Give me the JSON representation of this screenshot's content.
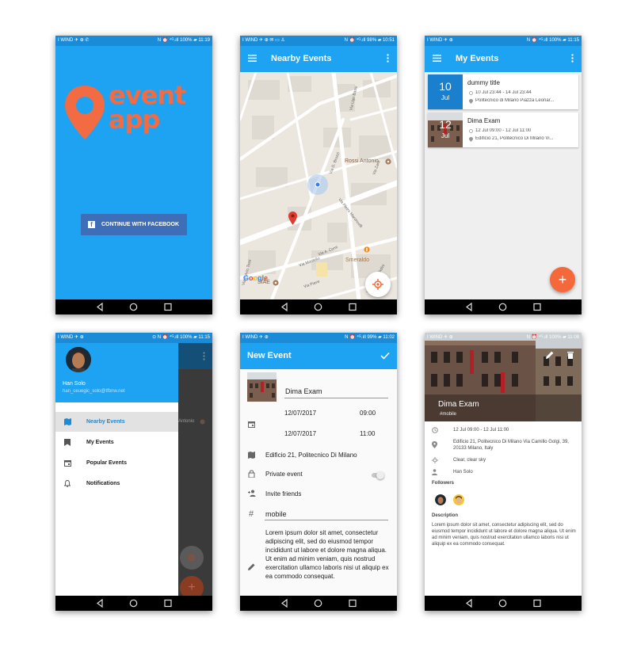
{
  "status": {
    "p1": {
      "left": "I WIND ✈ ⊕ ✆",
      "right": "N ⏰ ⁴ᴳ.ıll 100% ▰ 11:19"
    },
    "p2": {
      "left": "I WIND ✈ ⊕ ✉ ▭ ♙",
      "right": "N ⏰ ⁴ᴳ.ıll 98% ▰ 10:51"
    },
    "p3": {
      "left": "I WIND ✈ ⊕",
      "right": "N ⏰ ⁴ᴳ.ıll 100% ▰ 11:15"
    },
    "p4": {
      "left": "I WIND ✈ ⊕",
      "right": "⊙ N ⏰ ⁴ᴳ.ıll 100% ▰ 11:15"
    },
    "p5": {
      "left": "I WIND ✈ ⊕",
      "right": "N ⏰ ⁴ᴳ.ıll 99% ▰ 11:02"
    },
    "p6": {
      "left": "I WIND ✈ ⊕",
      "right": "N ⏰ ⁴ᴳ.ıll 100% ▰ 11:08"
    }
  },
  "splash": {
    "logo_line1": "event",
    "logo_line2": "app",
    "facebook_button": "CONTINUE WITH FACEBOOK",
    "facebook_icon": "f"
  },
  "nearby": {
    "title": "Nearby Events",
    "places": [
      "Rossi Antonio",
      "Smeraldo",
      "SIAE"
    ],
    "streets": [
      "Via Ugo Bassi",
      "Via G. Bruzzi",
      "Via Zara",
      "Via Fulvio Testi",
      "Via A. Comi",
      "Via Montello",
      "Via Pietro Maroncelli",
      "Via Piave",
      "Via Ettore Paladini"
    ],
    "google": "Google",
    "fab_label": "+"
  },
  "my_events": {
    "title": "My Events",
    "events": [
      {
        "day": "10",
        "month": "Jul",
        "title": "dummy title",
        "time": "10 Jul 23:44 - 14 Jul 23:44",
        "place": "Politecnico di Milano Piazza Leonar..."
      },
      {
        "day": "12",
        "month": "Jul",
        "title": "Dima Exam",
        "time": "12 Jul 09:00 - 12 Jul 11:00",
        "place": "Edificio 21, Politecnico Di Milano Vi..."
      }
    ],
    "fab_label": "+"
  },
  "drawer": {
    "user_name": "Han Solo",
    "user_email": "han_ceuegic_solo@tfbnw.net",
    "items": [
      {
        "label": "Nearby Events",
        "icon": "map-icon",
        "active": true
      },
      {
        "label": "My Events",
        "icon": "bookmark-icon",
        "active": false
      },
      {
        "label": "Popular Events",
        "icon": "calendar-icon",
        "active": false
      },
      {
        "label": "Notifications",
        "icon": "bell-icon",
        "active": false
      }
    ],
    "background_place": "Antonio",
    "fab_label": "+"
  },
  "new_event": {
    "title": "New Event",
    "event_title": "Dima Exam",
    "start_date": "12/07/2017",
    "start_time": "09:00",
    "end_date": "12/07/2017",
    "end_time": "11:00",
    "location": "Edificio 21, Politecnico Di Milano",
    "private_label": "Private event",
    "private_on": false,
    "invite_label": "Invite friends",
    "tag": "mobile",
    "description": "Lorem ipsum dolor sit amet, consectetur adipiscing elit, sed do eiusmod tempor incididunt ut labore et dolore magna aliqua. Ut enim ad minim veniam, quis nostrud exercitation ullamco laboris nisi ut aliquip ex ea commodo consequat."
  },
  "event_detail": {
    "title": "Dima Exam",
    "tag": "#mobile",
    "time": "12 Jul 09:00 - 12 Jul 11:00",
    "address": "Edificio 21, Politecnico Di Milano Via Camillo Golgi, 39, 20133 Milano, Italy",
    "weather": "Clear, clear sky",
    "owner": "Han Solo",
    "followers_label": "Followers",
    "description_label": "Description",
    "description": "Lorem ipsum dolor sit amet, consectetur adipiscing elit, sed do eiusmod tempor incididunt ut labore et dolore magna aliqua. Ut enim ad minim veniam, quis nostrud exercitation ullamco laboris nisi ut aliquip ex ea commodo consequat."
  },
  "colors": {
    "primary": "#1ea3f2",
    "status": "#1a8bd6",
    "accent": "#f4683a",
    "facebook": "#3f6eb8",
    "date_tile": "#1a7fcc"
  }
}
